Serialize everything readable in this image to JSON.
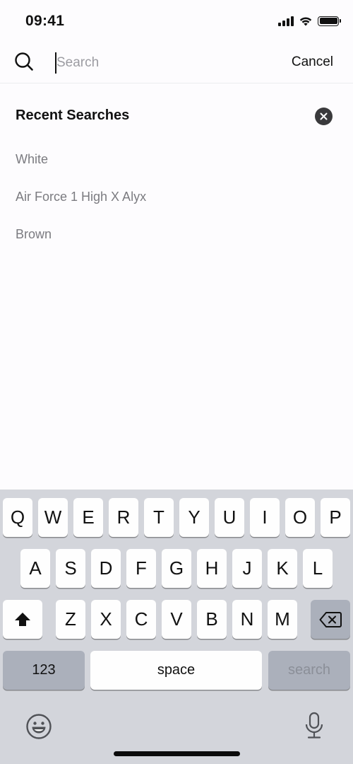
{
  "status_bar": {
    "time": "09:41",
    "icons": [
      "cellular-signal-icon",
      "wifi-icon",
      "battery-icon"
    ]
  },
  "search": {
    "icon": "search-icon",
    "placeholder": "Search",
    "value": "",
    "cancel_label": "Cancel"
  },
  "recent": {
    "title": "Recent Searches",
    "clear_icon": "clear-circle-icon",
    "items": [
      "White",
      "Air Force 1 High X Alyx",
      "Brown"
    ]
  },
  "keyboard": {
    "row1": [
      "Q",
      "W",
      "E",
      "R",
      "T",
      "Y",
      "U",
      "I",
      "O",
      "P"
    ],
    "row2": [
      "A",
      "S",
      "D",
      "F",
      "G",
      "H",
      "J",
      "K",
      "L"
    ],
    "row3": [
      "Z",
      "X",
      "C",
      "V",
      "B",
      "N",
      "M"
    ],
    "shift_icon": "shift-icon",
    "delete_icon": "backspace-icon",
    "numbers_label": "123",
    "space_label": "space",
    "return_label": "search",
    "emoji_icon": "emoji-icon",
    "mic_icon": "microphone-icon"
  }
}
